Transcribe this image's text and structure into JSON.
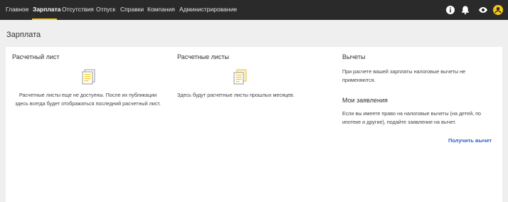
{
  "nav": {
    "items": [
      {
        "label": "Главное",
        "active": false
      },
      {
        "label": "Зарплата",
        "active": true
      },
      {
        "label": "Отсутствия",
        "active": false
      },
      {
        "label": "Отпуск",
        "active": false
      },
      {
        "label": "Справки",
        "active": false
      },
      {
        "label": "Компания",
        "active": false
      },
      {
        "label": "Администрирование",
        "active": false
      }
    ],
    "icons": [
      "info-icon",
      "bell-icon",
      "eye-icon",
      "avatar-icon"
    ],
    "accent_color": "#f5c518"
  },
  "page": {
    "title": "Зарплата"
  },
  "payslip": {
    "title": "Расчетный лист",
    "text": "Расчетные листы еще не доступны. После их публикации здесь всегда будет отображаться последний расчетный лист."
  },
  "payslips": {
    "title": "Расчетные листы",
    "text": "Здесь будут расчетные листы прошлых месяцев."
  },
  "deductions": {
    "title": "Вычеты",
    "text": "При расчете вашей зарплаты налоговые вычеты не применяются."
  },
  "applications": {
    "title": "Мои заявления",
    "text": "Если вы имеете право на налоговые вычеты (на детей, по ипотеке и другие), подайте заявление на вычет.",
    "link": "Получить вычет"
  }
}
